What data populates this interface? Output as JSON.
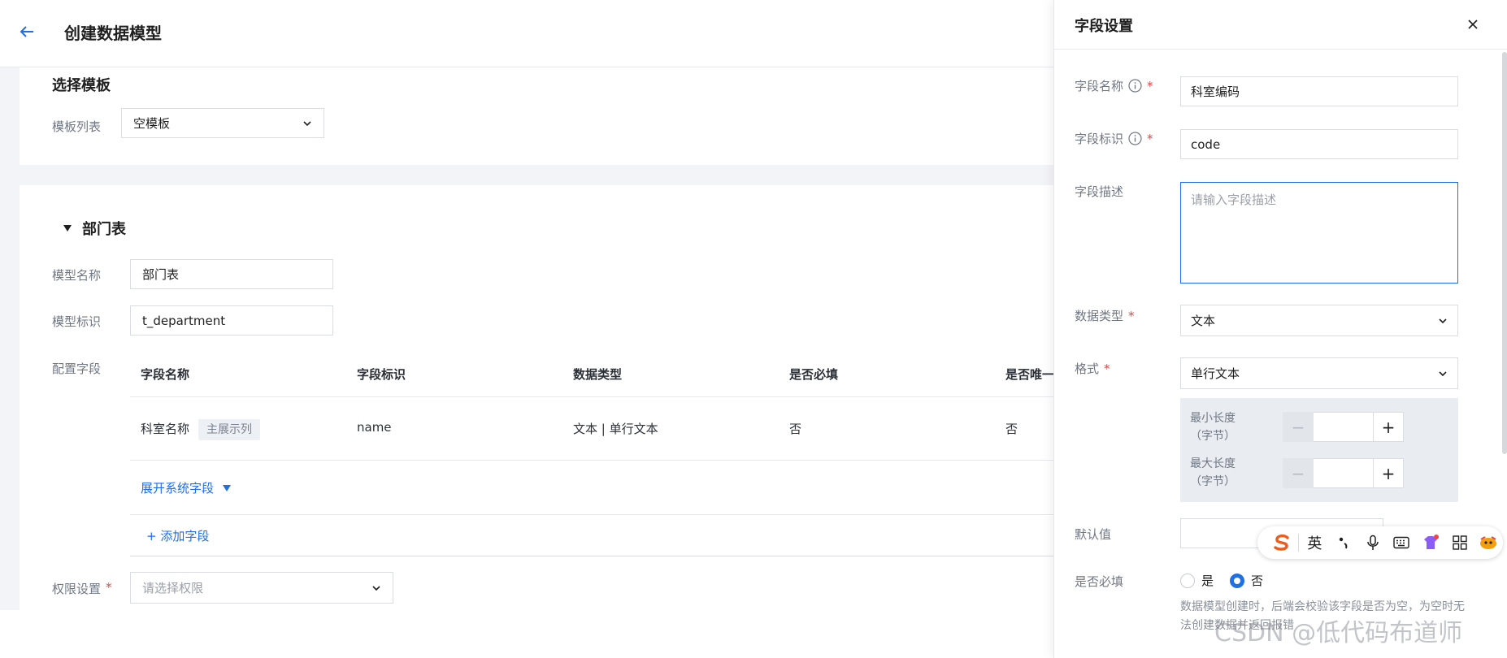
{
  "header": {
    "title": "创建数据模型"
  },
  "template_section": {
    "title": "选择模板",
    "list_label": "模板列表",
    "list_value": "空模板"
  },
  "dept_section": {
    "title": "部门表",
    "model_name_label": "模型名称",
    "model_name_value": "部门表",
    "model_id_label": "模型标识",
    "model_id_value": "t_department",
    "fields_label": "配置字段",
    "columns": [
      "字段名称",
      "字段标识",
      "数据类型",
      "是否必填",
      "是否唯一"
    ],
    "rows": [
      {
        "name": "科室名称",
        "tag": "主展示列",
        "id": "name",
        "type": "文本 | 单行文本",
        "required": "否",
        "unique": "否"
      }
    ],
    "expand_link": "展开系统字段",
    "add_link": "+ 添加字段",
    "permission_label": "权限设置",
    "permission_placeholder": "请选择权限"
  },
  "drawer": {
    "title": "字段设置",
    "field_name_label": "字段名称",
    "field_name_value": "科室编码",
    "field_id_label": "字段标识",
    "field_id_value": "code",
    "field_desc_label": "字段描述",
    "field_desc_placeholder": "请输入字段描述",
    "data_type_label": "数据类型",
    "data_type_value": "文本",
    "format_label": "格式",
    "format_value": "单行文本",
    "min_len_label_1": "最小长度",
    "min_len_label_2": "（字节）",
    "max_len_label_1": "最大长度",
    "max_len_label_2": "（字节）",
    "minus": "−",
    "plus": "+",
    "default_label": "默认值",
    "required_label": "是否必填",
    "radio_yes": "是",
    "radio_no": "否",
    "hint": "数据模型创建时，后端会校验该字段是否为空，为空时无法创建数据并返回报错"
  },
  "ime": {
    "lang": "英"
  },
  "watermark": "CSDN @低代码布道师",
  "colors": {
    "accent": "#1f6fe5",
    "required": "#e54545",
    "label": "#707784"
  }
}
